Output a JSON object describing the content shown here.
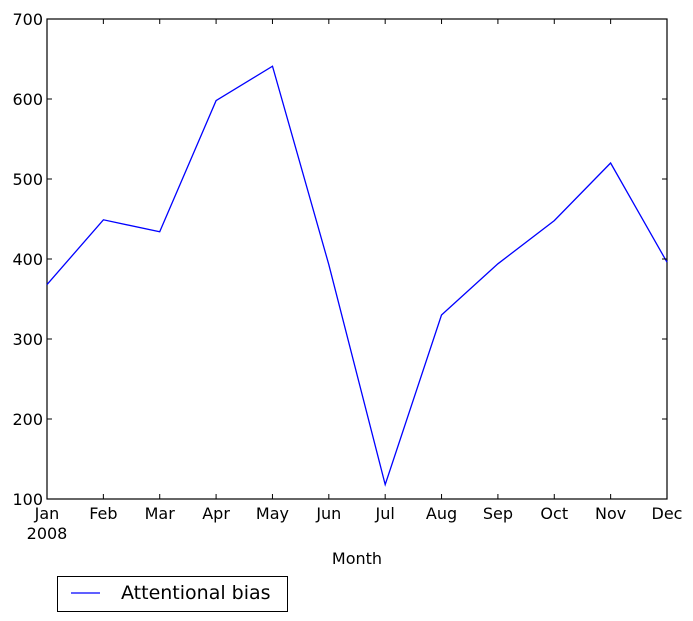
{
  "chart_data": {
    "type": "line",
    "title": "",
    "xlabel": "Month",
    "ylabel": "",
    "categories": [
      "Jan",
      "Feb",
      "Mar",
      "Apr",
      "May",
      "Jun",
      "Jul",
      "Aug",
      "Sep",
      "Oct",
      "Nov",
      "Dec"
    ],
    "x_year_label": "2008",
    "ylim": [
      100,
      700
    ],
    "yticks": [
      100,
      200,
      300,
      400,
      500,
      600,
      700
    ],
    "grid": false,
    "legend_position": "below-left",
    "series": [
      {
        "name": "Attentional bias",
        "color": "#0000ff",
        "values": [
          368,
          449,
          434,
          598,
          641,
          393,
          118,
          330,
          394,
          448,
          520,
          396
        ]
      }
    ]
  }
}
